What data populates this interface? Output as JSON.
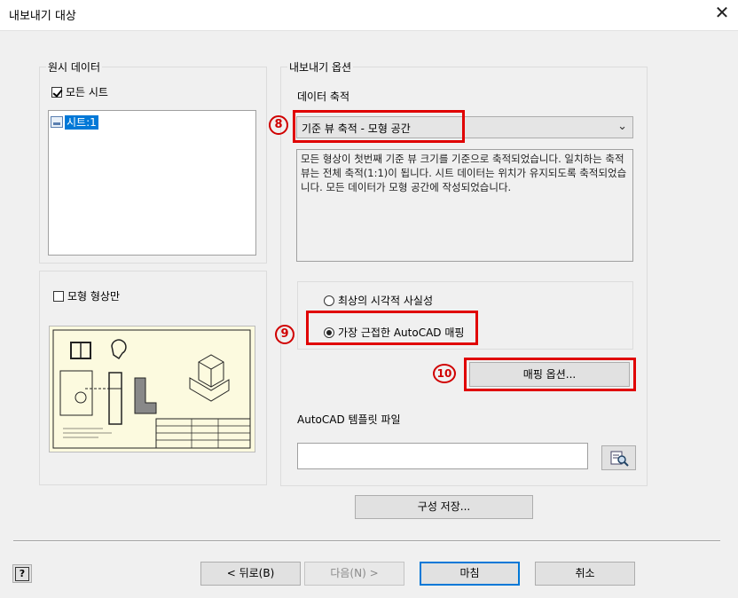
{
  "window": {
    "title": "내보내기 대상"
  },
  "source": {
    "legend": "원시 데이터",
    "all_sheets_label": "모든 시트",
    "all_sheets_checked": true,
    "sheets": [
      "시트:1"
    ],
    "model_geometry_label": "모형 형상만",
    "model_geometry_checked": false
  },
  "options": {
    "legend": "내보내기 옵션",
    "scale_label": "데이터 축적",
    "scale_selected": "기준 뷰 축적 - 모형 공간",
    "description": "모든 형상이 첫번째 기준 뷰 크기를 기준으로 축적되었습니다. 일치하는 축적 뷰는 전체 축적(1:1)이 됩니다. 시트 데이터는 위치가 유지되도록 축적되었습니다. 모든 데이터가 모형 공간에 작성되었습니다.",
    "radio_best_visual": "최상의 시각적 사실성",
    "radio_closest_mapping": "가장 근접한 AutoCAD 매핑",
    "radio_selected": "closest_mapping",
    "mapping_options_button": "매핑 옵션...",
    "template_label": "AutoCAD 템플릿 파일",
    "template_value": ""
  },
  "buttons": {
    "save_config": "구성 저장...",
    "back": "< 뒤로(B)",
    "next": "다음(N) >",
    "finish": "마침",
    "cancel": "취소",
    "help": "?"
  },
  "annotations": {
    "n8": "8",
    "n9": "9",
    "n10": "10"
  },
  "colors": {
    "highlight_red": "#e00000",
    "selection_blue": "#0078d7"
  }
}
